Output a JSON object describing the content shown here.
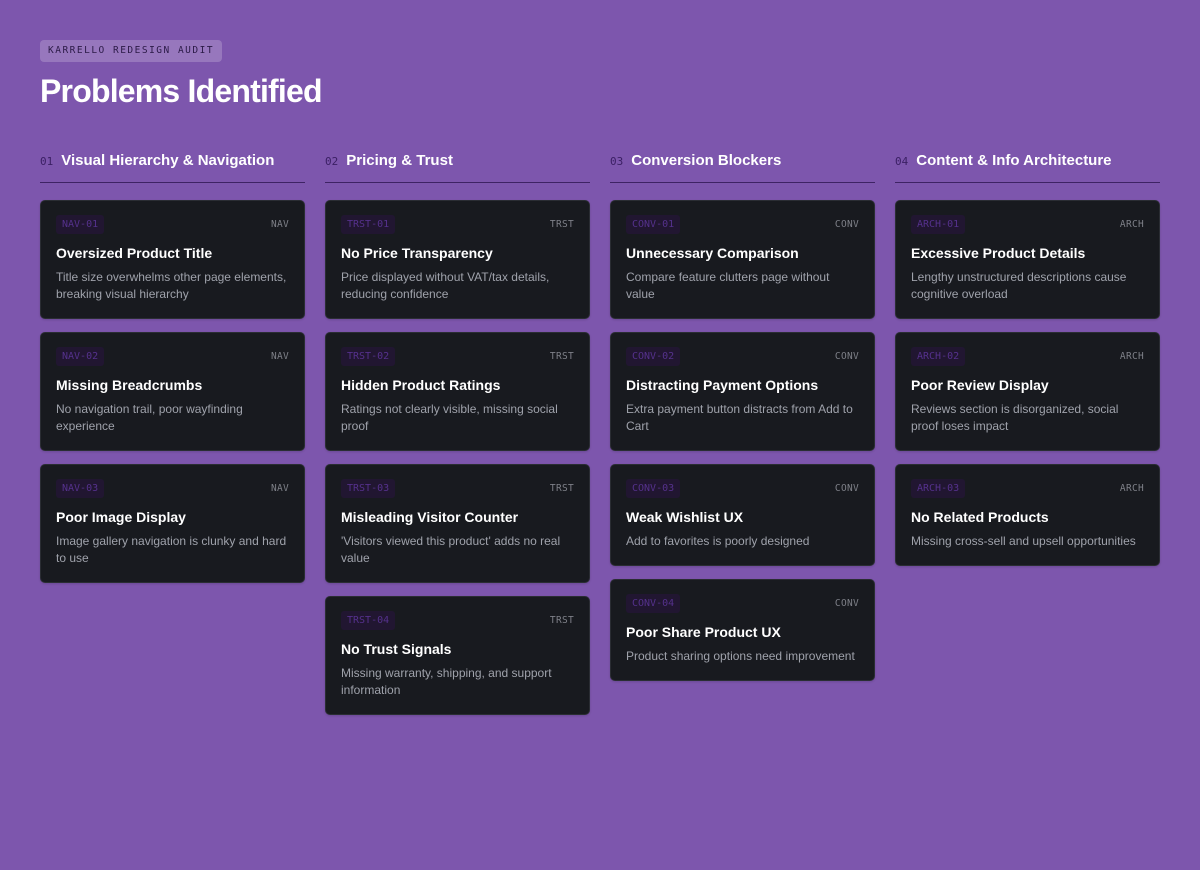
{
  "eyebrow": "KARRELLO REDESIGN AUDIT",
  "title": "Problems Identified",
  "colors": {
    "background": "#7d56ad",
    "card": "#181a1f",
    "tag_text": "#55318c",
    "tag_bg": "#211631",
    "number": "#3a1f63",
    "divider": "#3e2364"
  },
  "columns": [
    {
      "num": "01",
      "title": "Visual Hierarchy & Navigation",
      "cards": [
        {
          "tag": "NAV-01",
          "cat": "NAV",
          "title": "Oversized Product Title",
          "desc": "Title size overwhelms other page elements, breaking visual hierarchy"
        },
        {
          "tag": "NAV-02",
          "cat": "NAV",
          "title": "Missing Breadcrumbs",
          "desc": "No navigation trail, poor wayfinding experience"
        },
        {
          "tag": "NAV-03",
          "cat": "NAV",
          "title": "Poor Image Display",
          "desc": "Image gallery navigation is clunky and hard to use"
        }
      ]
    },
    {
      "num": "02",
      "title": "Pricing & Trust",
      "cards": [
        {
          "tag": "TRST-01",
          "cat": "TRST",
          "title": "No Price Transparency",
          "desc": "Price displayed without VAT/tax details, reducing confidence"
        },
        {
          "tag": "TRST-02",
          "cat": "TRST",
          "title": "Hidden Product Ratings",
          "desc": "Ratings not clearly visible, missing social proof"
        },
        {
          "tag": "TRST-03",
          "cat": "TRST",
          "title": "Misleading Visitor Counter",
          "desc": "'Visitors viewed this product' adds no real value"
        },
        {
          "tag": "TRST-04",
          "cat": "TRST",
          "title": "No Trust Signals",
          "desc": "Missing warranty, shipping, and support information"
        }
      ]
    },
    {
      "num": "03",
      "title": "Conversion Blockers",
      "cards": [
        {
          "tag": "CONV-01",
          "cat": "CONV",
          "title": "Unnecessary Comparison",
          "desc": "Compare feature clutters page without value"
        },
        {
          "tag": "CONV-02",
          "cat": "CONV",
          "title": "Distracting Payment Options",
          "desc": "Extra payment button distracts from Add to Cart"
        },
        {
          "tag": "CONV-03",
          "cat": "CONV",
          "title": "Weak Wishlist UX",
          "desc": "Add to favorites is poorly designed"
        },
        {
          "tag": "CONV-04",
          "cat": "CONV",
          "title": "Poor Share Product UX",
          "desc": "Product sharing options need improvement"
        }
      ]
    },
    {
      "num": "04",
      "title": "Content & Info Architecture",
      "cards": [
        {
          "tag": "ARCH-01",
          "cat": "ARCH",
          "title": "Excessive Product Details",
          "desc": "Lengthy unstructured descriptions cause cognitive overload"
        },
        {
          "tag": "ARCH-02",
          "cat": "ARCH",
          "title": "Poor Review Display",
          "desc": "Reviews section is disorganized, social proof loses impact"
        },
        {
          "tag": "ARCH-03",
          "cat": "ARCH",
          "title": "No Related Products",
          "desc": "Missing cross-sell and upsell opportunities"
        }
      ]
    }
  ]
}
